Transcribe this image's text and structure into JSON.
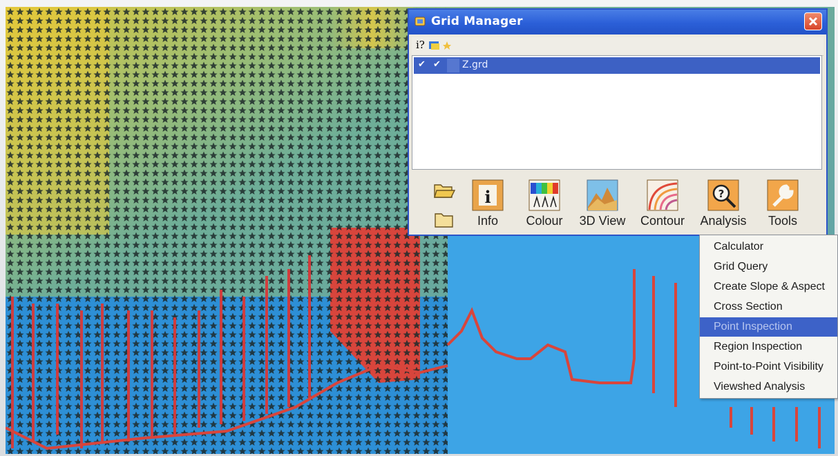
{
  "window": {
    "title": "Grid Manager",
    "grid_list": [
      {
        "checks": [
          "✔",
          "✔"
        ],
        "name": "Z.grd",
        "selected": true
      }
    ],
    "toolbar": {
      "info_glyph": "i?"
    },
    "buttons": [
      {
        "label": "Info",
        "icon": "info-icon"
      },
      {
        "label": "Colour",
        "icon": "colour-icon"
      },
      {
        "label": "3D View",
        "icon": "3d-view-icon"
      },
      {
        "label": "Contour",
        "icon": "contour-icon"
      },
      {
        "label": "Analysis",
        "icon": "analysis-icon"
      },
      {
        "label": "Tools",
        "icon": "tools-icon"
      }
    ],
    "side_icons": [
      "open-folder-icon",
      "folder-icon"
    ]
  },
  "tools_menu": {
    "items": [
      {
        "label": "Calculator"
      },
      {
        "label": "Grid Query"
      },
      {
        "label": "Create Slope & Aspect"
      },
      {
        "label": "Cross Section"
      },
      {
        "label": "Point Inspection",
        "highlighted": true
      },
      {
        "label": "Region Inspection"
      },
      {
        "label": "Point-to-Point Visibility"
      },
      {
        "label": "Viewshed Analysis"
      }
    ]
  },
  "colors": {
    "title_bar": "#2b5fd8",
    "selection": "#3d62c8",
    "map_yellow": "#e2c838",
    "map_green": "#6fae98",
    "map_blue": "#2a8ed8",
    "trace_red": "#d83a3a"
  }
}
